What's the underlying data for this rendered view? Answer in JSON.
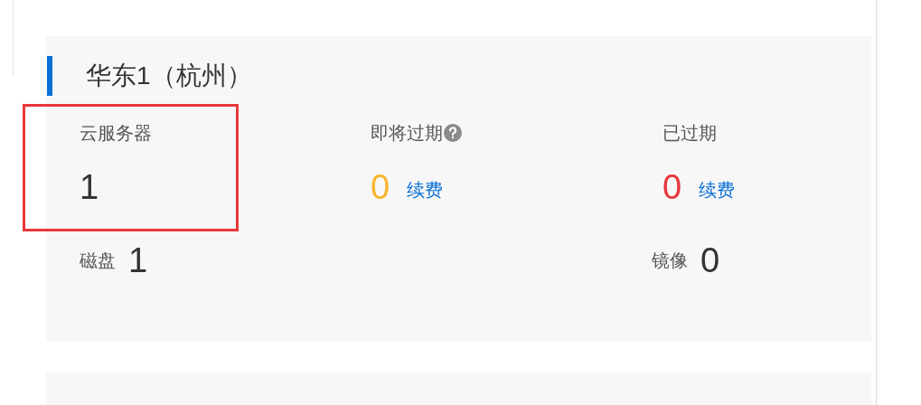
{
  "region": {
    "title": "华东1（杭州）"
  },
  "stats": [
    {
      "label": "云服务器",
      "value": "1",
      "kind": "plain",
      "help": false,
      "highlighted": true
    },
    {
      "label": "即将过期",
      "value": "0",
      "kind": "renew",
      "color": "#f8b62d",
      "help": true,
      "link": "续费",
      "highlighted": false
    },
    {
      "label": "已过期",
      "value": "0",
      "kind": "renew",
      "color": "#e8373a",
      "help": false,
      "link": "续费",
      "highlighted": false
    }
  ],
  "resources": [
    {
      "label": "磁盘",
      "value": "1"
    },
    {
      "label": "镜像",
      "value": "0"
    }
  ]
}
